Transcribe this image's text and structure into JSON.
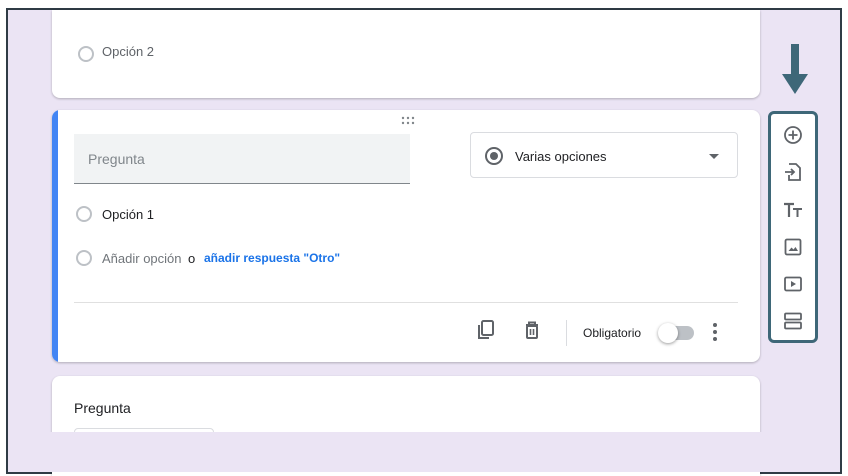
{
  "top_card": {
    "option_label": "Opción 2"
  },
  "question_card": {
    "question_placeholder": "Pregunta",
    "question_type": "Varias opciones",
    "option_1": "Opción 1",
    "add_option": "Añadir opción",
    "conjunction": "o",
    "add_other": "añadir respuesta \"Otro\"",
    "required_label": "Obligatorio",
    "required_on": false
  },
  "next_card": {
    "title": "Pregunta"
  },
  "toolbar": {
    "items": [
      "add-question-icon",
      "import-questions-icon",
      "add-title-icon",
      "add-image-icon",
      "add-video-icon",
      "add-section-icon"
    ]
  },
  "colors": {
    "accent": "#4285f4",
    "link": "#1a73e8",
    "arrow": "#3e6778",
    "toolbar_border": "#3e6778",
    "background": "#ebe4f4"
  }
}
